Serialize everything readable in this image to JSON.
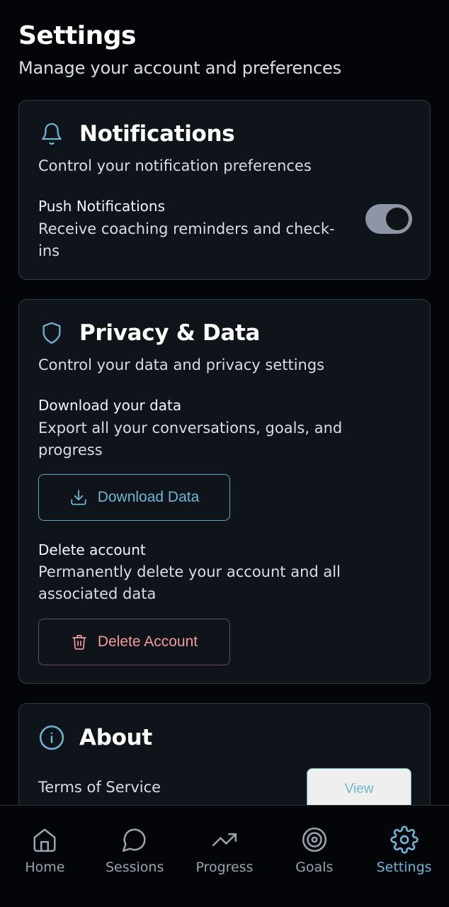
{
  "header": {
    "title": "Settings",
    "subtitle": "Manage your account and preferences"
  },
  "notifications": {
    "icon": "bell-icon",
    "title": "Notifications",
    "description": "Control your notification preferences",
    "push": {
      "label": "Push Notifications",
      "description": "Receive coaching reminders and check-ins",
      "enabled": true
    }
  },
  "privacy": {
    "icon": "shield-icon",
    "title": "Privacy & Data",
    "description": "Control your data and privacy settings",
    "download": {
      "label": "Download your data",
      "description": "Export all your conversations, goals, and progress",
      "button": "Download Data",
      "button_icon": "download-icon"
    },
    "delete": {
      "label": "Delete account",
      "description": "Permanently delete your account and all associated data",
      "button": "Delete Account",
      "button_icon": "trash-icon"
    }
  },
  "about": {
    "icon": "info-icon",
    "title": "About",
    "terms_label": "Terms of Service",
    "terms_button": "View"
  },
  "nav": {
    "items": [
      {
        "label": "Home",
        "icon": "home-icon",
        "active": false
      },
      {
        "label": "Sessions",
        "icon": "chat-bubble-icon",
        "active": false
      },
      {
        "label": "Progress",
        "icon": "trending-up-icon",
        "active": false
      },
      {
        "label": "Goals",
        "icon": "target-icon",
        "active": false
      },
      {
        "label": "Settings",
        "icon": "gear-icon",
        "active": true
      }
    ]
  },
  "colors": {
    "background": "#030508",
    "card": "#0f141b",
    "card_border": "#2e3a46",
    "accent": "#6fb4d2",
    "danger": "#f19b9b",
    "muted": "#9aa3ad"
  }
}
